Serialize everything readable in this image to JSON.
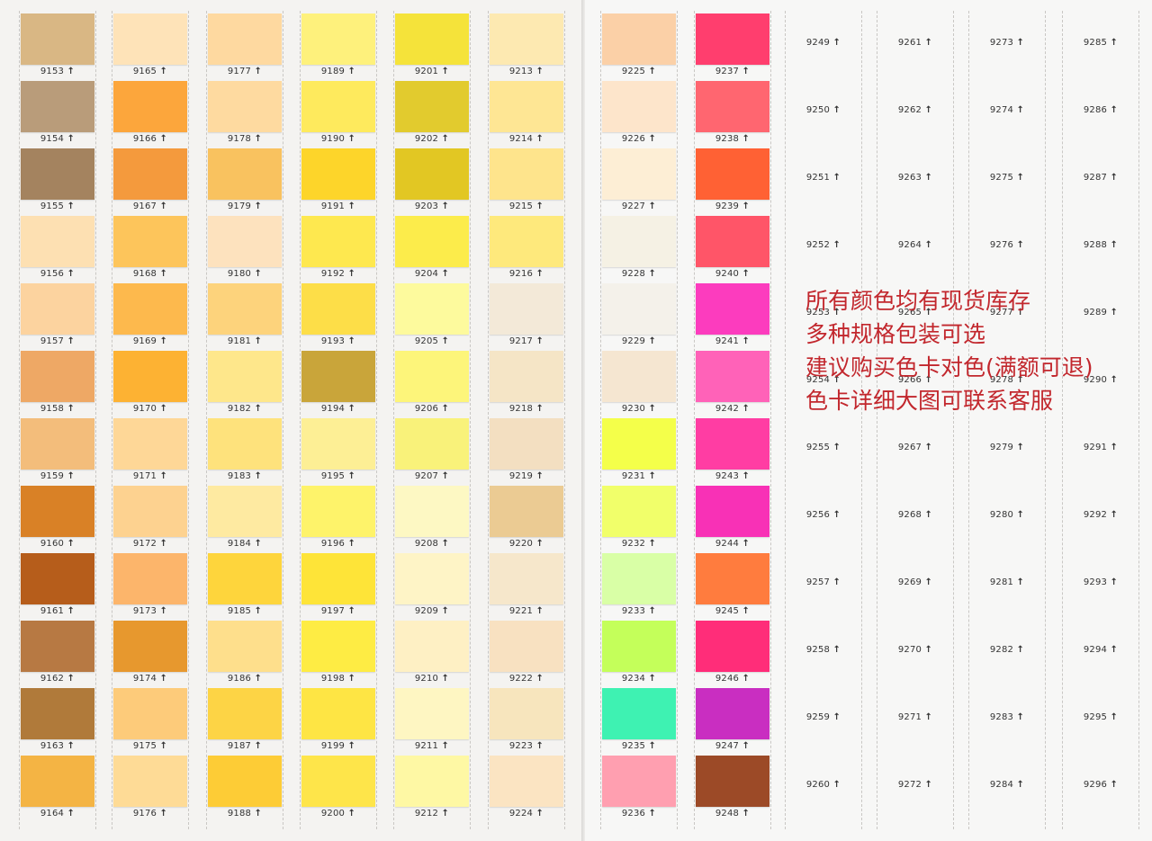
{
  "arrow": "↑",
  "left_page": {
    "columns": [
      [
        {
          "code": "9153",
          "color": "#d9b784"
        },
        {
          "code": "9154",
          "color": "#b99c7a"
        },
        {
          "code": "9155",
          "color": "#a4835f"
        },
        {
          "code": "9156",
          "color": "#fde0b2"
        },
        {
          "code": "9157",
          "color": "#fcd39f"
        },
        {
          "code": "9158",
          "color": "#eea865"
        },
        {
          "code": "9159",
          "color": "#f3bd7b"
        },
        {
          "code": "9160",
          "color": "#d98126"
        },
        {
          "code": "9161",
          "color": "#b65d1b"
        },
        {
          "code": "9162",
          "color": "#b77943"
        },
        {
          "code": "9163",
          "color": "#b07a3a"
        },
        {
          "code": "9164",
          "color": "#f4b444"
        }
      ],
      [
        {
          "code": "9165",
          "color": "#fee3b8"
        },
        {
          "code": "9166",
          "color": "#fca63c"
        },
        {
          "code": "9167",
          "color": "#f49a3d"
        },
        {
          "code": "9168",
          "color": "#fdc55b"
        },
        {
          "code": "9169",
          "color": "#fdb94d"
        },
        {
          "code": "9170",
          "color": "#fdb233"
        },
        {
          "code": "9171",
          "color": "#fed797"
        },
        {
          "code": "9172",
          "color": "#fdd290"
        },
        {
          "code": "9173",
          "color": "#fcb56b"
        },
        {
          "code": "9174",
          "color": "#e7982e"
        },
        {
          "code": "9175",
          "color": "#fdcb7a"
        },
        {
          "code": "9176",
          "color": "#fedb96"
        }
      ],
      [
        {
          "code": "9177",
          "color": "#fed9a0"
        },
        {
          "code": "9178",
          "color": "#fedaa0"
        },
        {
          "code": "9179",
          "color": "#f9c25f"
        },
        {
          "code": "9180",
          "color": "#fde2be"
        },
        {
          "code": "9181",
          "color": "#fdd37c"
        },
        {
          "code": "9182",
          "color": "#fee78b"
        },
        {
          "code": "9183",
          "color": "#fee27c"
        },
        {
          "code": "9184",
          "color": "#feeaa1"
        },
        {
          "code": "9185",
          "color": "#fed53c"
        },
        {
          "code": "9186",
          "color": "#fedf8c"
        },
        {
          "code": "9187",
          "color": "#fdd445"
        },
        {
          "code": "9188",
          "color": "#fdcc36"
        }
      ],
      [
        {
          "code": "9189",
          "color": "#fef17c"
        },
        {
          "code": "9190",
          "color": "#feea5d"
        },
        {
          "code": "9191",
          "color": "#fdd52a"
        },
        {
          "code": "9192",
          "color": "#fee84f"
        },
        {
          "code": "9193",
          "color": "#fdde48"
        },
        {
          "code": "9194",
          "color": "#c9a53a"
        },
        {
          "code": "9195",
          "color": "#fdef95"
        },
        {
          "code": "9196",
          "color": "#fef36a"
        },
        {
          "code": "9197",
          "color": "#fee438"
        },
        {
          "code": "9198",
          "color": "#feec44"
        },
        {
          "code": "9199",
          "color": "#fee544"
        },
        {
          "code": "9200",
          "color": "#fee54a"
        }
      ],
      [
        {
          "code": "9201",
          "color": "#f5e33a"
        },
        {
          "code": "9202",
          "color": "#e2cb2e"
        },
        {
          "code": "9203",
          "color": "#e2c723"
        },
        {
          "code": "9204",
          "color": "#fcec4b"
        },
        {
          "code": "9205",
          "color": "#fdfa9d"
        },
        {
          "code": "9206",
          "color": "#fdf57a"
        },
        {
          "code": "9207",
          "color": "#f9f27a"
        },
        {
          "code": "9208",
          "color": "#fdf8c3"
        },
        {
          "code": "9209",
          "color": "#fef4c6"
        },
        {
          "code": "9210",
          "color": "#fef0c4"
        },
        {
          "code": "9211",
          "color": "#fef6c2"
        },
        {
          "code": "9212",
          "color": "#fef8a4"
        }
      ],
      [
        {
          "code": "9213",
          "color": "#fde9b1"
        },
        {
          "code": "9214",
          "color": "#fee694"
        },
        {
          "code": "9215",
          "color": "#fee48c"
        },
        {
          "code": "9216",
          "color": "#fee97c"
        },
        {
          "code": "9217",
          "color": "#f3e9d8"
        },
        {
          "code": "9218",
          "color": "#f5e5c6"
        },
        {
          "code": "9219",
          "color": "#f3dfc1"
        },
        {
          "code": "9220",
          "color": "#ebcb93"
        },
        {
          "code": "9221",
          "color": "#f6e7cb"
        },
        {
          "code": "9222",
          "color": "#f8e1c1"
        },
        {
          "code": "9223",
          "color": "#f7e5bd"
        },
        {
          "code": "9224",
          "color": "#fbe4c2"
        }
      ]
    ]
  },
  "right_page": {
    "columns": [
      [
        {
          "code": "9225",
          "color": "#fbd0a7"
        },
        {
          "code": "9226",
          "color": "#fde5cb"
        },
        {
          "code": "9227",
          "color": "#fdeed5"
        },
        {
          "code": "9228",
          "color": "#f5f1e4"
        },
        {
          "code": "9229",
          "color": "#f4f1ea"
        },
        {
          "code": "9230",
          "color": "#f5e6d1"
        },
        {
          "code": "9231",
          "color": "#f4ff4a"
        },
        {
          "code": "9232",
          "color": "#f1ff6a"
        },
        {
          "code": "9233",
          "color": "#d9ffa6"
        },
        {
          "code": "9234",
          "color": "#c4ff5a"
        },
        {
          "code": "9235",
          "color": "#3ef2b2"
        },
        {
          "code": "9236",
          "color": "#ff9fb0"
        }
      ],
      [
        {
          "code": "9237",
          "color": "#ff3e6e"
        },
        {
          "code": "9238",
          "color": "#ff6670"
        },
        {
          "code": "9239",
          "color": "#ff6134"
        },
        {
          "code": "9240",
          "color": "#ff5568"
        },
        {
          "code": "9241",
          "color": "#fc3cbe"
        },
        {
          "code": "9242",
          "color": "#ff62b8"
        },
        {
          "code": "9243",
          "color": "#ff3da3"
        },
        {
          "code": "9244",
          "color": "#f831b6"
        },
        {
          "code": "9245",
          "color": "#ff7c3e"
        },
        {
          "code": "9246",
          "color": "#ff2d79"
        },
        {
          "code": "9247",
          "color": "#c92ec1"
        },
        {
          "code": "9248",
          "color": "#9c4a27"
        }
      ],
      [
        {
          "code": "9249"
        },
        {
          "code": "9250"
        },
        {
          "code": "9251"
        },
        {
          "code": "9252"
        },
        {
          "code": "9253"
        },
        {
          "code": "9254"
        },
        {
          "code": "9255"
        },
        {
          "code": "9256"
        },
        {
          "code": "9257"
        },
        {
          "code": "9258"
        },
        {
          "code": "9259"
        },
        {
          "code": "9260"
        }
      ],
      [
        {
          "code": "9261"
        },
        {
          "code": "9262"
        },
        {
          "code": "9263"
        },
        {
          "code": "9264"
        },
        {
          "code": "9265"
        },
        {
          "code": "9266"
        },
        {
          "code": "9267"
        },
        {
          "code": "9268"
        },
        {
          "code": "9269"
        },
        {
          "code": "9270"
        },
        {
          "code": "9271"
        },
        {
          "code": "9272"
        }
      ],
      [
        {
          "code": "9273"
        },
        {
          "code": "9274"
        },
        {
          "code": "9275"
        },
        {
          "code": "9276"
        },
        {
          "code": "9277"
        },
        {
          "code": "9278"
        },
        {
          "code": "9279"
        },
        {
          "code": "9280"
        },
        {
          "code": "9281"
        },
        {
          "code": "9282"
        },
        {
          "code": "9283"
        },
        {
          "code": "9284"
        }
      ],
      [
        {
          "code": "9285"
        },
        {
          "code": "9286"
        },
        {
          "code": "9287"
        },
        {
          "code": "9288"
        },
        {
          "code": "9289"
        },
        {
          "code": "9290"
        },
        {
          "code": "9291"
        },
        {
          "code": "9292"
        },
        {
          "code": "9293"
        },
        {
          "code": "9294"
        },
        {
          "code": "9295"
        },
        {
          "code": "9296"
        }
      ]
    ]
  },
  "notice": {
    "line1": "所有颜色均有现货库存",
    "line2": "多种规格包装可选",
    "line3": "建议购买色卡对色(满额可退)",
    "line4": "色卡详细大图可联系客服",
    "color": "#c2272d"
  }
}
